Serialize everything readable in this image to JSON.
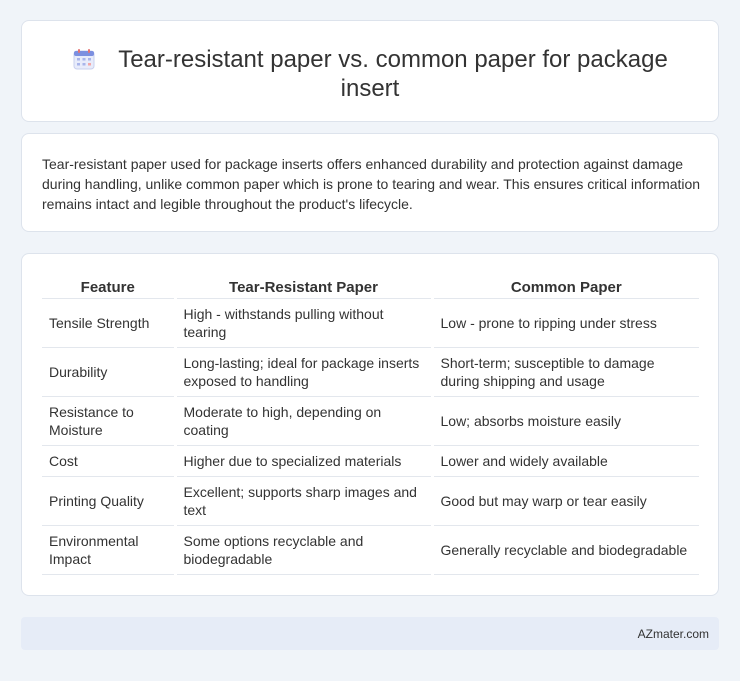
{
  "header": {
    "icon": "calendar-icon",
    "title_line1": "Tear-resistant paper vs. common paper for package",
    "title_line2": "insert"
  },
  "intro": {
    "text": "Tear-resistant paper used for package inserts offers enhanced durability and protection against damage during handling, unlike common paper which is prone to tearing and wear. This ensures critical information remains intact and legible throughout the product's lifecycle."
  },
  "table": {
    "headers": [
      "Feature",
      "Tear-Resistant Paper",
      "Common Paper"
    ],
    "rows": [
      [
        "Tensile Strength",
        "High - withstands pulling without tearing",
        "Low - prone to ripping under stress"
      ],
      [
        "Durability",
        "Long-lasting; ideal for package inserts exposed to handling",
        "Short-term; susceptible to damage during shipping and usage"
      ],
      [
        "Resistance to Moisture",
        "Moderate to high, depending on coating",
        "Low; absorbs moisture easily"
      ],
      [
        "Cost",
        "Higher due to specialized materials",
        "Lower and widely available"
      ],
      [
        "Printing Quality",
        "Excellent; supports sharp images and text",
        "Good but may warp or tear easily"
      ],
      [
        "Environmental Impact",
        "Some options recyclable and biodegradable",
        "Generally recyclable and biodegradable"
      ]
    ]
  },
  "footer": {
    "brand": "AZmater.com"
  }
}
